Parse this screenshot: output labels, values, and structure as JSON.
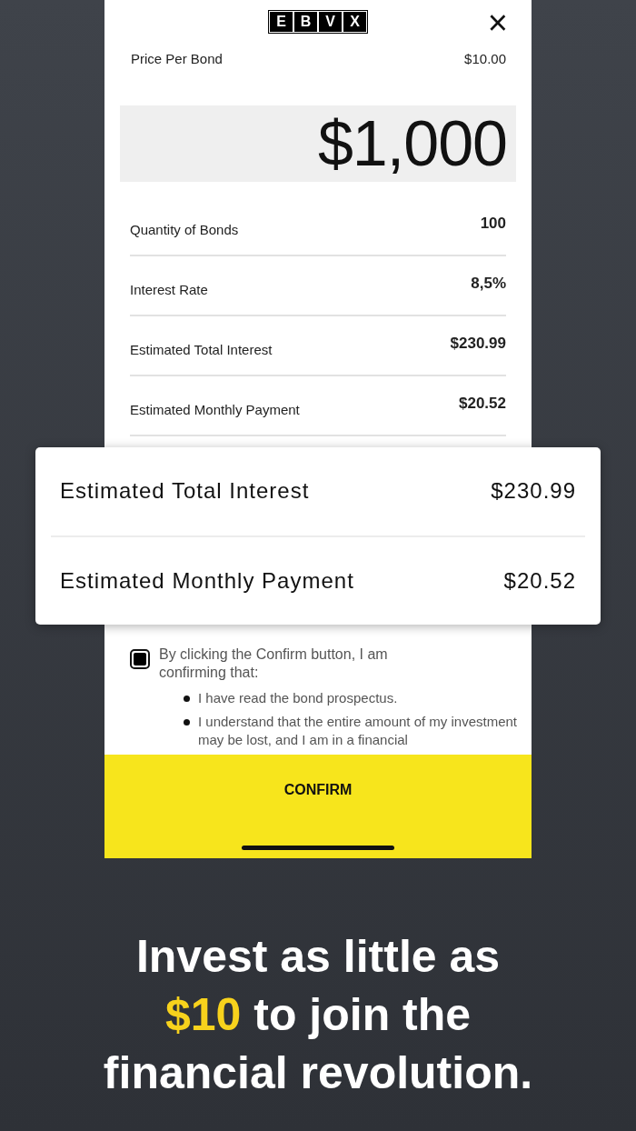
{
  "logo_letters": [
    "E",
    "B",
    "V",
    "X"
  ],
  "close": "×",
  "price_per_bond": {
    "label": "Price Per Bond",
    "value": "$10.00"
  },
  "amount": "$1,000",
  "details": [
    {
      "label": "Quantity of Bonds",
      "value": "100"
    },
    {
      "label": "Interest Rate",
      "value": "8,5%"
    },
    {
      "label": "Estimated Total Interest",
      "value": "$230.99"
    },
    {
      "label": "Estimated Monthly Payment",
      "value": "$20.52"
    }
  ],
  "highlight_card": [
    {
      "label": "Estimated Total Interest",
      "value": "$230.99"
    },
    {
      "label": "Estimated Monthly Payment",
      "value": "$20.52"
    }
  ],
  "consent": {
    "checked": true,
    "text": "By clicking the Confirm button, I am confirming that:",
    "bullets": [
      "I have read the bond prospectus.",
      "I understand that the entire amount of my investment may be lost, and I am in a financial"
    ]
  },
  "confirm_button": "CONFIRM",
  "headline": [
    [
      {
        "text": "Invest as little as",
        "highlight": false
      }
    ],
    [
      {
        "text": "$10",
        "highlight": true
      },
      {
        "text": " to join the",
        "highlight": false
      }
    ],
    [
      {
        "text": "financial revolution.",
        "highlight": false
      }
    ]
  ]
}
